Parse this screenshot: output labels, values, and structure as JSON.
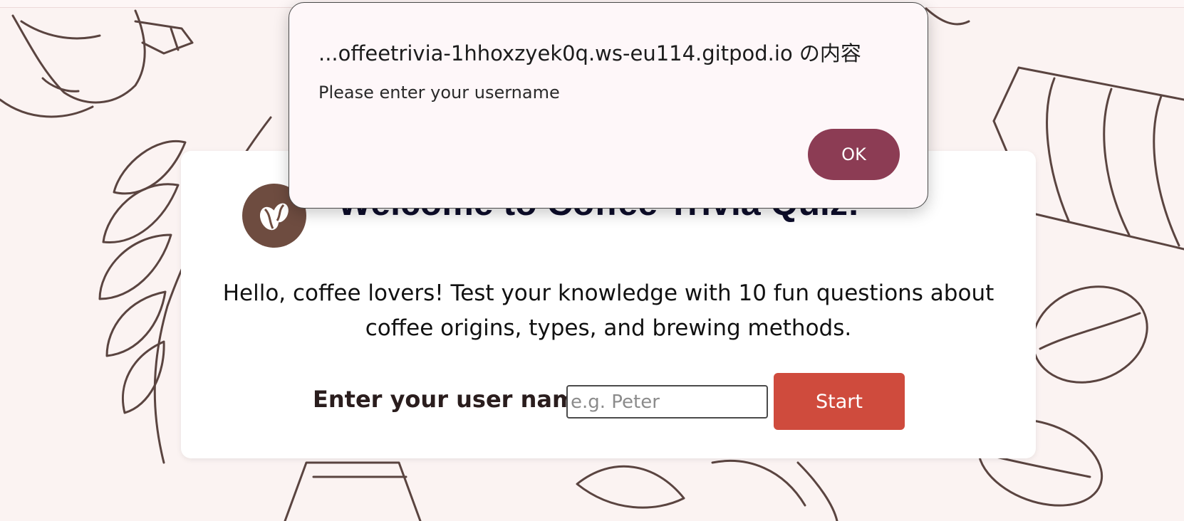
{
  "page": {
    "background_color": "#fbf3f2"
  },
  "card": {
    "title": "Welcome to Coffee Trivia Quiz!",
    "logo_icon": "coffee-beans-icon",
    "intro_line1": "Hello, coffee lovers! Test your knowledge with 10 fun questions about",
    "intro_line2": "coffee origins, types, and brewing methods.",
    "username_label": "Enter your user name",
    "username_value": "",
    "username_placeholder": "e.g. Peter",
    "start_label": "Start",
    "start_color": "#cf4b3d"
  },
  "dialog": {
    "title": "...offeetrivia-1hhoxzyek0q.ws-eu114.gitpod.io の内容",
    "message": "Please enter your username",
    "ok_label": "OK",
    "ok_color": "#8c3c54"
  }
}
